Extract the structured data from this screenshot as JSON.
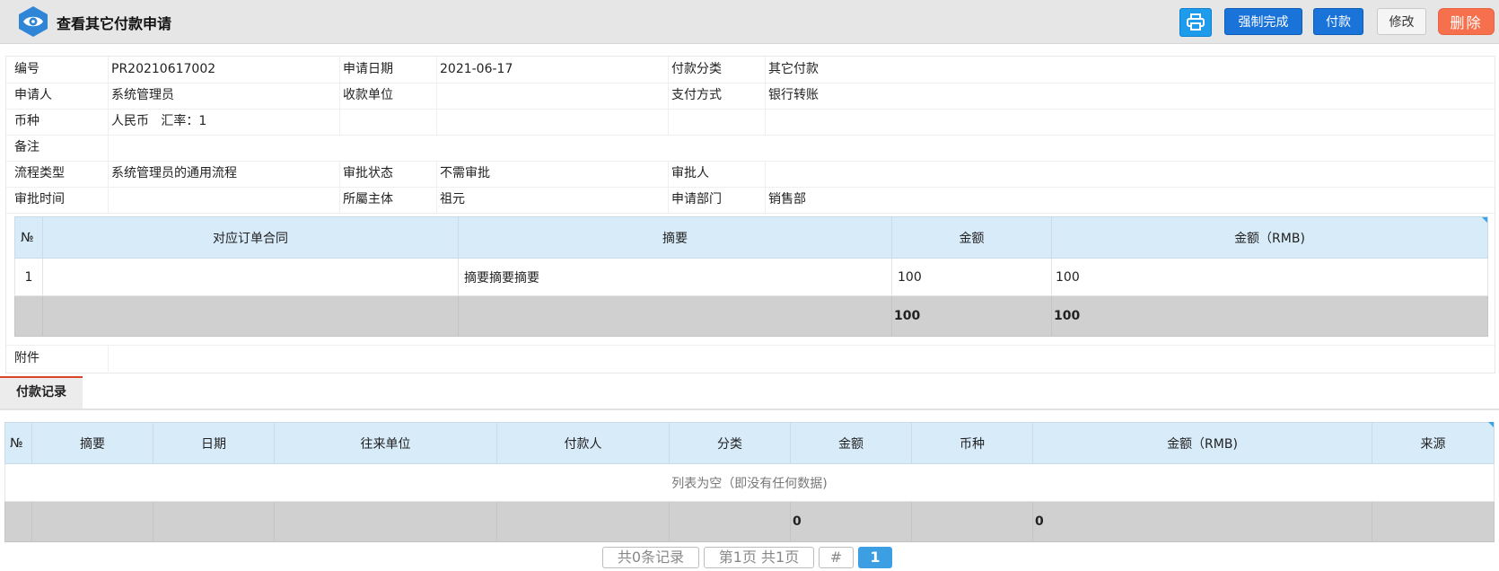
{
  "header": {
    "title": "查看其它付款申请",
    "buttons": {
      "force_complete": "强制完成",
      "pay": "付款",
      "edit": "修改",
      "delete": "删除"
    }
  },
  "form": {
    "rows": [
      [
        {
          "label": "编号",
          "value": "PR20210617002"
        },
        {
          "label": "申请日期",
          "value": "2021-06-17"
        },
        {
          "label": "付款分类",
          "value": "其它付款"
        }
      ],
      [
        {
          "label": "申请人",
          "value": "系统管理员"
        },
        {
          "label": "收款单位",
          "value": ""
        },
        {
          "label": "支付方式",
          "value": "银行转账"
        }
      ],
      [
        {
          "label": "币种",
          "value": "人民币   汇率：1"
        },
        {
          "label": "",
          "value": ""
        },
        {
          "label": "",
          "value": ""
        }
      ],
      [
        {
          "label": "备注",
          "value": ""
        }
      ],
      [
        {
          "label": "流程类型",
          "value": "系统管理员的通用流程"
        },
        {
          "label": "审批状态",
          "value": "不需审批"
        },
        {
          "label": "审批人",
          "value": ""
        }
      ],
      [
        {
          "label": "审批时间",
          "value": ""
        },
        {
          "label": "所屬主体",
          "value": "祖元"
        },
        {
          "label": "申请部门",
          "value": "销售部"
        }
      ]
    ],
    "attachment_label": "附件"
  },
  "detail_table": {
    "headers": [
      "№",
      "对应订单合同",
      "摘要",
      "金额",
      "金额（RMB)"
    ],
    "rows": [
      [
        "1",
        "",
        "摘要摘要摘要",
        "100",
        "100"
      ]
    ],
    "totals": [
      "",
      "",
      "",
      "100",
      "100"
    ]
  },
  "tabs": [
    {
      "label": "付款记录"
    }
  ],
  "record_table": {
    "headers": [
      "№",
      "摘要",
      "日期",
      "往来单位",
      "付款人",
      "分类",
      "金额",
      "币种",
      "金额（RMB)",
      "来源"
    ],
    "empty_text": "列表为空（即没有任何数据)",
    "totals": [
      "",
      "",
      "",
      "",
      "",
      "",
      "0",
      "",
      "0",
      ""
    ]
  },
  "pager": {
    "total": "共0条记录",
    "page_info": "第1页 共1页",
    "hash": "#",
    "current": "1"
  },
  "colors": {
    "accent": "#1a73d8",
    "danger": "#f7704d",
    "header_bg": "#d8ebf9",
    "tab_accent": "#d9442d"
  },
  "icons": {
    "logo": "eye-icon",
    "print": "printer-icon"
  }
}
